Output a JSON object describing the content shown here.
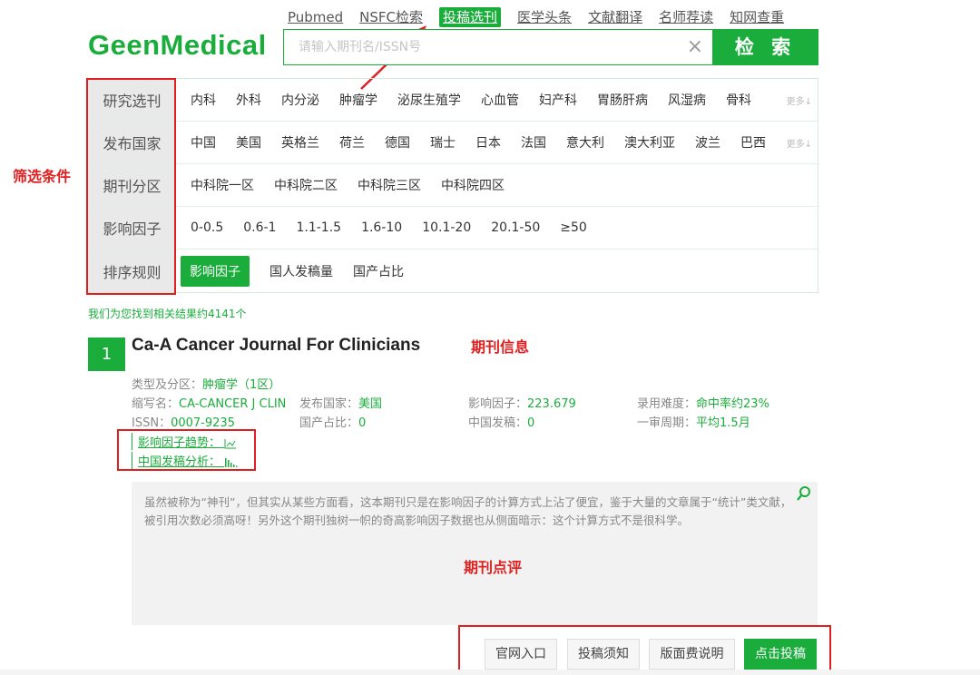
{
  "nav": {
    "items": [
      "Pubmed",
      "NSFC检索",
      "投稿选刊",
      "医学头条",
      "文献翻译",
      "名师荐读",
      "知网查重"
    ],
    "active_index": 2
  },
  "logo": "GeenMedical",
  "search": {
    "placeholder": "请输入期刊名/ISSN号",
    "clear_icon": "×",
    "button_label": "检 索"
  },
  "filters": [
    {
      "label": "研究选刊",
      "options": [
        "内科",
        "外科",
        "内分泌",
        "肿瘤学",
        "泌尿生殖学",
        "心血管",
        "妇产科",
        "胃肠肝病",
        "风湿病",
        "骨科"
      ],
      "more": "更多↓"
    },
    {
      "label": "发布国家",
      "options": [
        "中国",
        "美国",
        "英格兰",
        "荷兰",
        "德国",
        "瑞士",
        "日本",
        "法国",
        "意大利",
        "澳大利亚",
        "波兰",
        "巴西"
      ],
      "more": "更多↓"
    },
    {
      "label": "期刊分区",
      "options": [
        "中科院一区",
        "中科院二区",
        "中科院三区",
        "中科院四区"
      ]
    },
    {
      "label": "影响因子",
      "options": [
        "0-0.5",
        "0.6-1",
        "1.1-1.5",
        "1.6-10",
        "10.1-20",
        "20.1-50",
        "≥50"
      ]
    },
    {
      "label": "排序规则",
      "options": [
        "影响因子",
        "国人发稿量",
        "国产占比"
      ],
      "selected_index": 0
    }
  ],
  "annotations": {
    "filter": "筛选条件",
    "journal_info": "期刊信息",
    "review": "期刊点评"
  },
  "results_count": "我们为您找到相关结果约4141个",
  "journal": {
    "rank": "1",
    "title": "Ca-A Cancer Journal For Clinicians",
    "type_label": "类型及分区：",
    "type_value": "肿瘤学（1区）",
    "abbr_label": "缩写名：",
    "abbr_value": "CA-CANCER J CLIN",
    "country_label": "发布国家：",
    "country_value": "美国",
    "if_label": "影响因子：",
    "if_value": "223.679",
    "difficulty_label": "录用难度：",
    "difficulty_value": "命中率约23%",
    "issn_label": "ISSN：",
    "issn_value": "0007-9235",
    "domestic_label": "国产占比：",
    "domestic_value": "0",
    "china_label": "中国发稿：",
    "china_value": "0",
    "review_cycle_label": "一审周期：",
    "review_cycle_value": "平均1.5月",
    "trend_label": "影响因子趋势：",
    "analysis_label": "中国发稿分析："
  },
  "review_text": "虽然被称为“神刊”，但其实从某些方面看，这本期刊只是在影响因子的计算方式上沾了便宜，鉴于大量的文章属于“统计”类文献，被引用次数必须高呀！另外这个期刊独树一帜的奇高影响因子数据也从侧面暗示：这个计算方式不是很科学。",
  "actions": [
    "官网入口",
    "投稿须知",
    "版面费说明",
    "点击投稿"
  ],
  "colors": {
    "brand": "#1aad3c",
    "annotation": "#e02020"
  }
}
